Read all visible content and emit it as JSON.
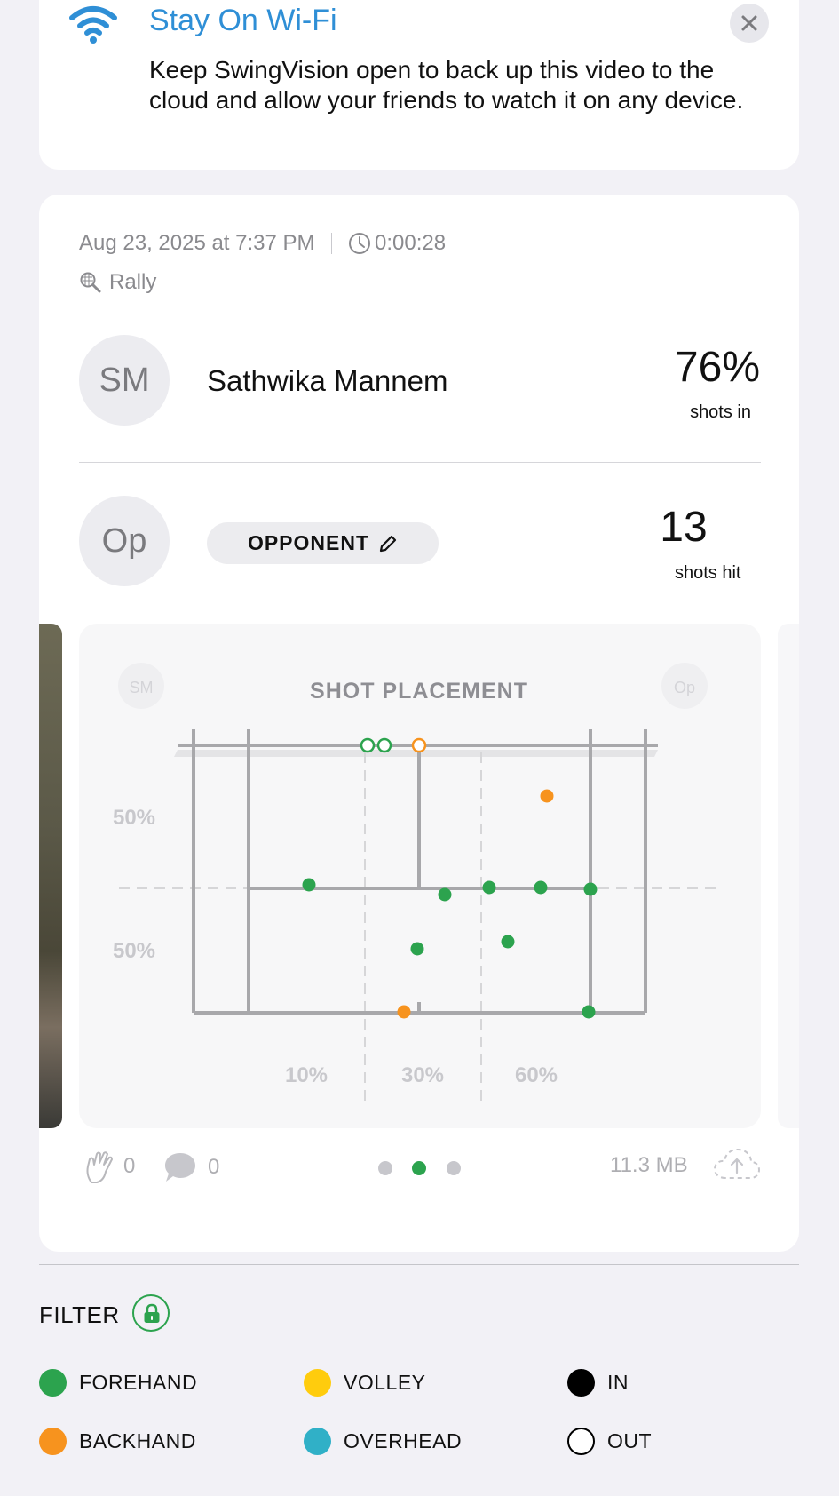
{
  "wifi_banner": {
    "title": "Stay On Wi-Fi",
    "body": "Keep SwingVision open to back up this video to the cloud and allow your friends to watch it on any device."
  },
  "session": {
    "date": "Aug 23, 2025 at 7:37 PM",
    "duration": "0:00:28",
    "type": "Rally",
    "player": {
      "initials": "SM",
      "name": "Sathwika Mannem",
      "stat_value": "76%",
      "stat_label": "shots in"
    },
    "opponent": {
      "initials": "Op",
      "button_label": "OPPONENT",
      "stat_value": "13",
      "stat_label": "shots hit"
    },
    "shot_placement": {
      "title": "SHOT PLACEMENT",
      "left_badge": "SM",
      "right_badge": "Op",
      "depth_labels": [
        "50%",
        "50%"
      ],
      "width_labels": [
        "10%",
        "30%",
        "60%"
      ]
    },
    "footer": {
      "claps": "0",
      "comments": "0",
      "file_size": "11.3 MB",
      "pages": 3,
      "active_page": 1
    }
  },
  "filter": {
    "title": "FILTER",
    "items": [
      {
        "label": "FOREHAND",
        "color": "#2ca34e",
        "filled": true
      },
      {
        "label": "VOLLEY",
        "color": "#ffcc0d",
        "filled": true
      },
      {
        "label": "IN",
        "color": "#000000",
        "filled": true
      },
      {
        "label": "BACKHAND",
        "color": "#f7931e",
        "filled": true
      },
      {
        "label": "OVERHEAD",
        "color": "#30b0c7",
        "filled": true
      },
      {
        "label": "OUT",
        "color": "#000000",
        "filled": false
      }
    ]
  },
  "colors": {
    "forehand": "#2ca34e",
    "backhand": "#f7931e",
    "accent_blue": "#2f8fd6"
  }
}
